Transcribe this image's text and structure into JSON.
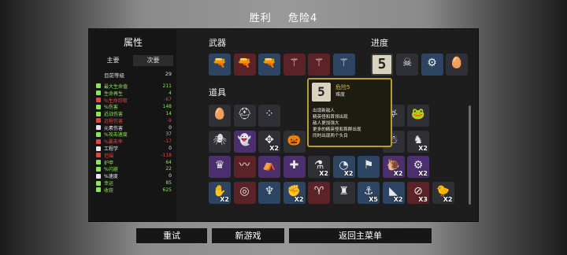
{
  "header": {
    "result": "胜利",
    "danger": "危险4"
  },
  "stats": {
    "title": "属性",
    "tabs": [
      "主要",
      "次要"
    ],
    "level_label": "目前等级",
    "level_value": "29",
    "rows": [
      {
        "name": "最大生命值",
        "value": "211",
        "color": "#8ee45b",
        "icon": "heart-icon"
      },
      {
        "name": "生命再生",
        "value": "4",
        "color": "#8ee45b",
        "icon": "regen-icon"
      },
      {
        "name": "%生命窃取",
        "value": "-67",
        "color": "#e14646",
        "icon": "lifesteal-icon"
      },
      {
        "name": "%伤害",
        "value": "148",
        "color": "#8ee45b",
        "icon": "damage-icon"
      },
      {
        "name": "近战伤害",
        "value": "14",
        "color": "#8ee45b",
        "icon": "melee-icon"
      },
      {
        "name": "远程伤害",
        "value": "-9",
        "color": "#e14646",
        "icon": "ranged-icon"
      },
      {
        "name": "元素伤害",
        "value": "0",
        "color": "#e8e8e8",
        "icon": "elemental-icon"
      },
      {
        "name": "%攻击速度",
        "value": "37",
        "color": "#8ee45b",
        "icon": "attack-speed-icon"
      },
      {
        "name": "%暴击率",
        "value": "-17",
        "color": "#e14646",
        "icon": "crit-icon"
      },
      {
        "name": "工程学",
        "value": "0",
        "color": "#e8e8e8",
        "icon": "engineering-icon"
      },
      {
        "name": "范围",
        "value": "-118",
        "color": "#e14646",
        "icon": "range-icon"
      },
      {
        "name": "护甲",
        "value": "64",
        "color": "#8ee45b",
        "icon": "armor-icon"
      },
      {
        "name": "%闪避",
        "value": "22",
        "color": "#8ee45b",
        "icon": "dodge-icon"
      },
      {
        "name": "%速度",
        "value": "0",
        "color": "#e8e8e8",
        "icon": "speed-icon"
      },
      {
        "name": "幸运",
        "value": "85",
        "color": "#8ee45b",
        "icon": "luck-icon"
      },
      {
        "name": "收获",
        "value": "625",
        "color": "#8ee45b",
        "icon": "harvest-icon"
      }
    ]
  },
  "weapons": {
    "label": "武器",
    "items": [
      {
        "icon": "gun-icon",
        "glyph": "🔫",
        "tier": "t2"
      },
      {
        "icon": "gun-icon",
        "glyph": "🔫",
        "tier": "t4"
      },
      {
        "icon": "gun-icon",
        "glyph": "🔫",
        "tier": "t2"
      },
      {
        "icon": "wand-icon",
        "glyph": "⚚",
        "tier": "t4"
      },
      {
        "icon": "wand-icon",
        "glyph": "⚚",
        "tier": "t4"
      },
      {
        "icon": "wand-icon",
        "glyph": "⚚",
        "tier": "t2"
      }
    ]
  },
  "progress": {
    "label": "进度",
    "danger_number": "5",
    "items": [
      {
        "icon": "skull-mask-icon",
        "glyph": "☠",
        "tier": "t1"
      },
      {
        "icon": "turret-icon",
        "glyph": "⚙",
        "tier": "t2"
      },
      {
        "icon": "egg-chick-icon",
        "glyph": "🥚",
        "tier": "t1"
      }
    ]
  },
  "items": {
    "label": "道具",
    "rows": [
      [
        {
          "icon": "egg-icon",
          "glyph": "🥚",
          "tier": "t1",
          "qty": ""
        },
        {
          "icon": "helmet-icon",
          "glyph": "⛑",
          "tier": "t1",
          "qty": ""
        },
        {
          "icon": "dots-icon",
          "glyph": "⁘",
          "tier": "t1",
          "qty": ""
        },
        {
          "icon": "hidden-icon",
          "glyph": "",
          "tier": "t1",
          "qty": ""
        },
        {
          "icon": "hidden-icon",
          "glyph": "",
          "tier": "t1",
          "qty": ""
        },
        {
          "icon": "hidden-icon",
          "glyph": "",
          "tier": "t1",
          "qty": ""
        },
        {
          "icon": "hidden-icon",
          "glyph": "",
          "tier": "t1",
          "qty": ""
        },
        {
          "icon": "pentagram-icon",
          "glyph": "⛧",
          "tier": "t1",
          "qty": ""
        },
        {
          "icon": "frog-icon",
          "glyph": "🐸",
          "tier": "t1",
          "qty": ""
        }
      ],
      [
        {
          "icon": "spider-icon",
          "glyph": "🕷",
          "tier": "t1",
          "qty": ""
        },
        {
          "icon": "ghost-icon",
          "glyph": "👻",
          "tier": "t3",
          "qty": ""
        },
        {
          "icon": "claw-icon",
          "glyph": "✥",
          "tier": "t1",
          "qty": "X2"
        },
        {
          "icon": "pumpkin-icon",
          "glyph": "🎃",
          "tier": "t1",
          "qty": ""
        },
        {
          "icon": "hidden-icon",
          "glyph": "",
          "tier": "t1",
          "qty": ""
        },
        {
          "icon": "hidden-icon",
          "glyph": "",
          "tier": "t1",
          "qty": ""
        },
        {
          "icon": "hidden-icon",
          "glyph": "",
          "tier": "t1",
          "qty": ""
        },
        {
          "icon": "scarecrow-icon",
          "glyph": "☃",
          "tier": "t1",
          "qty": ""
        },
        {
          "icon": "knight-icon",
          "glyph": "♞",
          "tier": "t1",
          "qty": "X2"
        }
      ],
      [
        {
          "icon": "crown-icon",
          "glyph": "♛",
          "tier": "t3",
          "qty": ""
        },
        {
          "icon": "scarf-icon",
          "glyph": "〰",
          "tier": "t4",
          "qty": ""
        },
        {
          "icon": "hood-icon",
          "glyph": "⛺",
          "tier": "t3",
          "qty": ""
        },
        {
          "icon": "medkit-icon",
          "glyph": "✚",
          "tier": "t3",
          "qty": ""
        },
        {
          "icon": "potion-icon",
          "glyph": "⚗",
          "tier": "t1",
          "qty": "X2"
        },
        {
          "icon": "bandage-icon",
          "glyph": "◔",
          "tier": "t2",
          "qty": "X2"
        },
        {
          "icon": "flag-icon",
          "glyph": "⚑",
          "tier": "t2",
          "qty": ""
        },
        {
          "icon": "snail-icon",
          "glyph": "🐌",
          "tier": "t3",
          "qty": "X2"
        },
        {
          "icon": "robot-icon",
          "glyph": "⚙",
          "tier": "t3",
          "qty": "X2"
        }
      ],
      [
        {
          "icon": "glove-icon",
          "glyph": "✋",
          "tier": "t2",
          "qty": "X2"
        },
        {
          "icon": "ring-icon",
          "glyph": "◎",
          "tier": "t4",
          "qty": ""
        },
        {
          "icon": "octopus-icon",
          "glyph": "♆",
          "tier": "t2",
          "qty": ""
        },
        {
          "icon": "arm-icon",
          "glyph": "✊",
          "tier": "t2",
          "qty": "X2"
        },
        {
          "icon": "horn-icon",
          "glyph": "♈",
          "tier": "t4",
          "qty": ""
        },
        {
          "icon": "coat-icon",
          "glyph": "♜",
          "tier": "t1",
          "qty": ""
        },
        {
          "icon": "hook-icon",
          "glyph": "⚓",
          "tier": "t2",
          "qty": "X5"
        },
        {
          "icon": "shard-icon",
          "glyph": "◣",
          "tier": "t2",
          "qty": "X2"
        },
        {
          "icon": "no-potion-icon",
          "glyph": "⊘",
          "tier": "t4",
          "qty": "X3"
        },
        {
          "icon": "duck-icon",
          "glyph": "🐤",
          "tier": "t1",
          "qty": "X2"
        }
      ]
    ]
  },
  "tooltip": {
    "number": "5",
    "name": "危险5",
    "subtitle": "难度",
    "lines": [
      "出现新敌人",
      "精英怪和首领出现",
      "敌人更加强大",
      "更多的精英怪和首群出现",
      "同时出现两个头目"
    ]
  },
  "buttons": {
    "retry": "重试",
    "new_game": "新游戏",
    "main_menu": "返回主菜单"
  }
}
